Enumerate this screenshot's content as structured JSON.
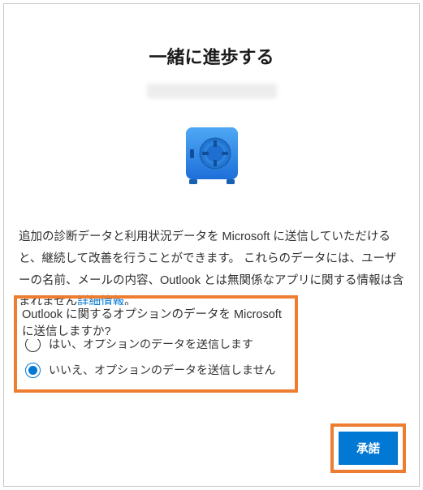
{
  "title": "一緒に進歩する",
  "body": {
    "text_before_link": "追加の診断データと利用状況データを Microsoft に送信していただけると、継続して改善を行うことができます。 これらのデータには、ユーザーの名前、メールの内容、Outlook とは無関係なアプリに関する情報は含まれません",
    "link": "詳細情報",
    "period": "。"
  },
  "question": "Outlook に関するオプションのデータを Microsoft に送信しますか?",
  "options": {
    "yes": "はい、オプションのデータを送信します",
    "no": "いいえ、オプションのデータを送信しません"
  },
  "button": {
    "accept": "承諾"
  },
  "colors": {
    "accent": "#0078d4",
    "highlight": "#ed7d31"
  }
}
